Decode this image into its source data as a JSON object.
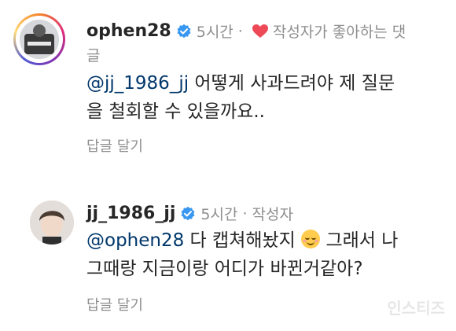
{
  "comments": [
    {
      "username": "ophen28",
      "time": "5시간",
      "dot": "·",
      "liked_label_line1": "작성자가 좋아하는 댓",
      "liked_label_line2": "글",
      "mention": "@jj_1986_jj",
      "text_line1_rest": " 어떻게 사과드려야 제 질문",
      "text_line2": "을 철회할 수 있을까요..",
      "reply_label": "답글 달기"
    },
    {
      "username": "jj_1986_jj",
      "time": "5시간",
      "dot": "·",
      "author_label": "작성자",
      "mention": "@ophen28",
      "text_line1_a": " 다 캡쳐해놨지",
      "text_line1_b": " 그래서 나",
      "text_line2": "그때랑 지금이랑 어디가 바뀐거같아?",
      "reply_label": "답글 달기"
    }
  ],
  "icons": {
    "verified": "verified-badge-icon",
    "heart": "heart-icon",
    "emoji": "smiling-face-emoji"
  },
  "colors": {
    "verified": "#3897f0",
    "heart": "#ed4956",
    "mention": "#00376b",
    "meta": "#8e8e8e"
  },
  "watermark": "인스티즈"
}
